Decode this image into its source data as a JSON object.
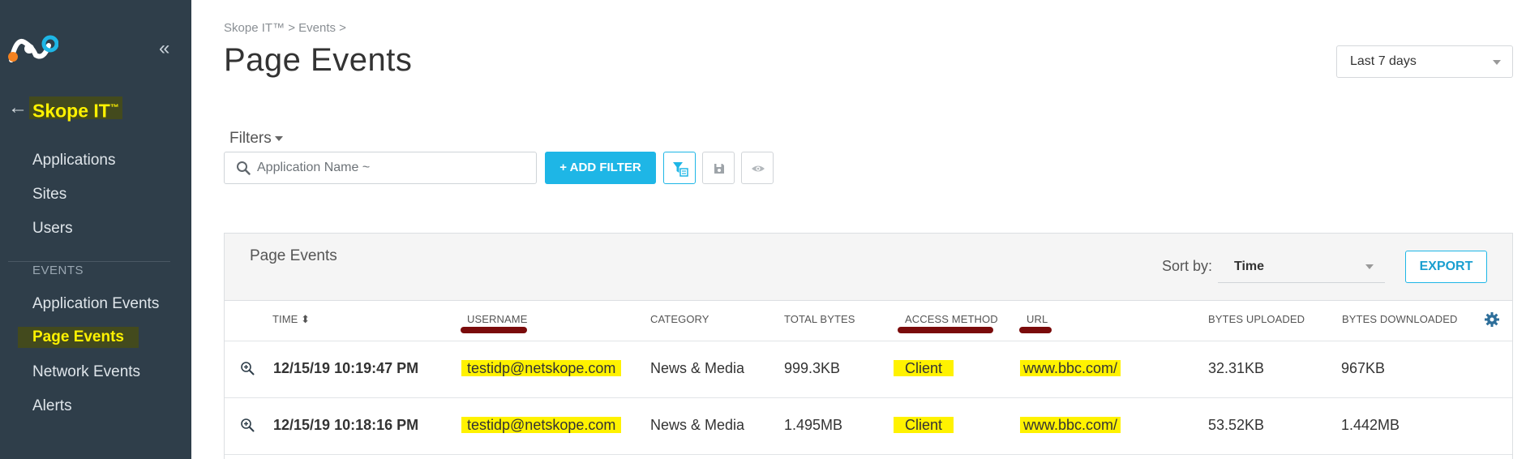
{
  "sidebar": {
    "collapse_glyph": "«",
    "back_glyph": "←",
    "section_title": "Skope IT",
    "section_title_mark": "™",
    "items": [
      {
        "label": "Applications"
      },
      {
        "label": "Sites"
      },
      {
        "label": "Users"
      }
    ],
    "events_heading": "EVENTS",
    "event_items": [
      {
        "label": "Application Events"
      },
      {
        "label": "Page Events"
      },
      {
        "label": "Network Events"
      },
      {
        "label": "Alerts"
      }
    ],
    "highlight_color": "#fff200"
  },
  "header": {
    "breadcrumb": "Skope IT™ > Events >",
    "title": "Page Events",
    "date_range": "Last 7 days"
  },
  "filters": {
    "label": "Filters",
    "search_placeholder": "Application Name ~",
    "add_filter_label": "+ ADD FILTER"
  },
  "panel": {
    "title": "Page Events",
    "sort_label": "Sort by:",
    "sort_value": "Time",
    "export_label": "EXPORT"
  },
  "table": {
    "columns": [
      {
        "label": "TIME",
        "sort_glyph": "⬍"
      },
      {
        "label": "USERNAME"
      },
      {
        "label": "CATEGORY"
      },
      {
        "label": "TOTAL BYTES"
      },
      {
        "label": "ACCESS METHOD"
      },
      {
        "label": "URL"
      },
      {
        "label": "BYTES UPLOADED"
      },
      {
        "label": "BYTES DOWNLOADED"
      }
    ],
    "rows": [
      {
        "time": "12/15/19 10:19:47 PM",
        "username": "testidp@netskope.com",
        "category": "News & Media",
        "total_bytes": "999.3KB",
        "access_method": "Client",
        "url": "www.bbc.com/",
        "bytes_uploaded": "32.31KB",
        "bytes_downloaded": "967KB"
      },
      {
        "time": "12/15/19 10:18:16 PM",
        "username": "testidp@netskope.com",
        "category": "News & Media",
        "total_bytes": "1.495MB",
        "access_method": "Client",
        "url": "www.bbc.com/",
        "bytes_uploaded": "53.52KB",
        "bytes_downloaded": "1.442MB"
      }
    ]
  },
  "colors": {
    "sidebar_bg": "#2f3e4a",
    "accent_blue": "#1eb6e6",
    "annotation_underline": "#7a0b0b"
  }
}
